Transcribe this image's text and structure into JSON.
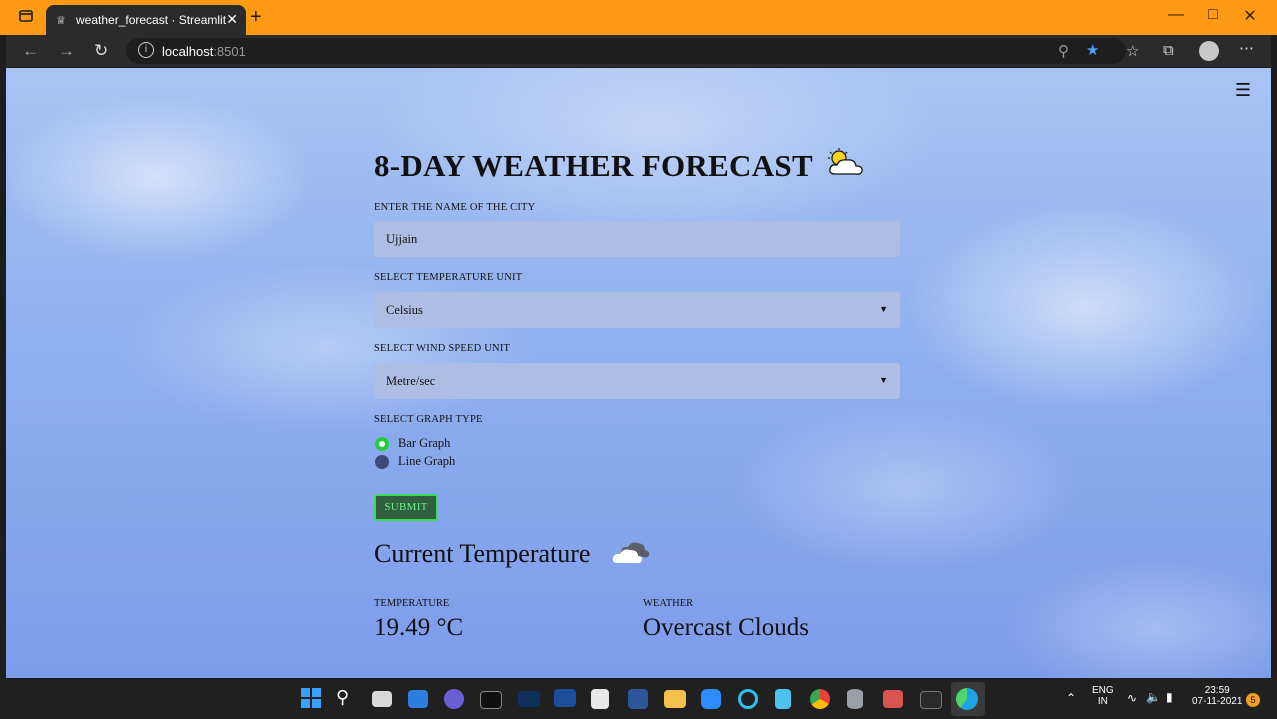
{
  "browser": {
    "tab_title": "weather_forecast · Streamlit",
    "url_host": "localhost",
    "url_port": ":8501"
  },
  "app": {
    "title": "8-DAY WEATHER FORECAST",
    "city_label": "ENTER THE NAME OF THE CITY",
    "city_value": "Ujjain",
    "temp_unit_label": "SELECT TEMPERATURE UNIT",
    "temp_unit_value": "Celsius",
    "wind_unit_label": "SELECT WIND SPEED UNIT",
    "wind_unit_value": "Metre/sec",
    "graph_type_label": "SELECT GRAPH TYPE",
    "graph_options": [
      "Bar Graph",
      "Line Graph"
    ],
    "graph_selected": "Bar Graph",
    "submit_label": "SUBMIT",
    "current_heading": "Current Temperature",
    "temperature_label": "TEMPERATURE",
    "temperature_value": "19.49 °C",
    "weather_label": "WEATHER",
    "weather_value": "Overcast Clouds"
  },
  "taskbar": {
    "lang_top": "ENG",
    "lang_bottom": "IN",
    "time": "23:59",
    "date": "07-11-2021",
    "notifications": "5"
  },
  "colors": {
    "titlebar": "#ff9a14",
    "accent_green": "#3ddc57",
    "field_bg": "#aebde4"
  }
}
